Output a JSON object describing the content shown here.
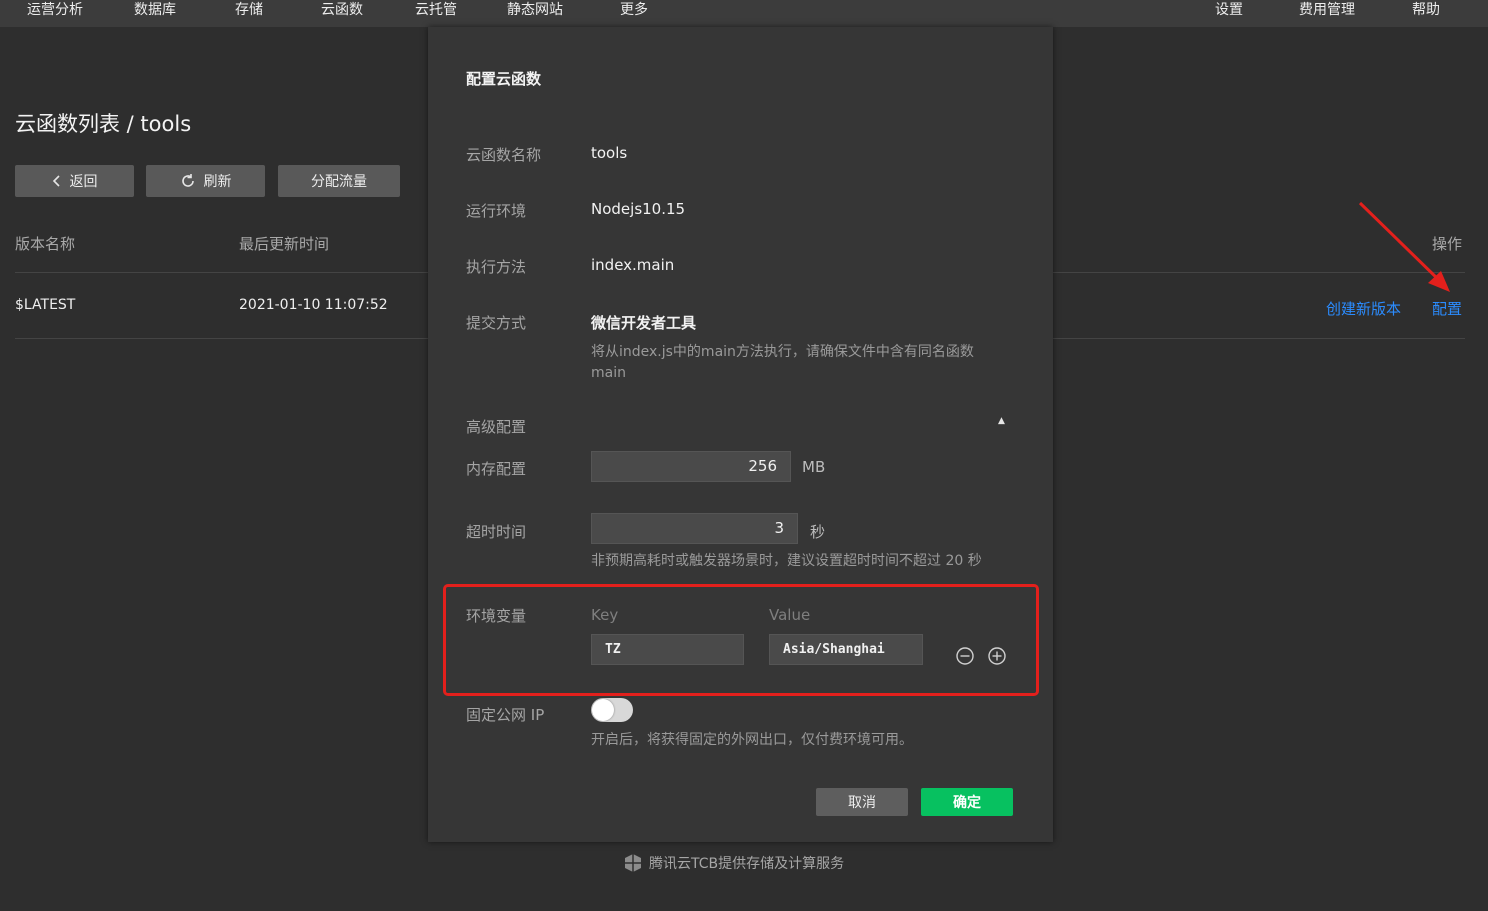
{
  "nav": {
    "left": [
      "运营分析",
      "数据库",
      "存储",
      "云函数",
      "云托管",
      "静态网站",
      "更多"
    ],
    "right": [
      "设置",
      "费用管理",
      "帮助"
    ]
  },
  "page": {
    "title": "云函数列表 / tools",
    "buttons": {
      "back": "返回",
      "refresh": "刷新",
      "traffic": "分配流量"
    },
    "table": {
      "headers": {
        "version": "版本名称",
        "updated": "最后更新时间",
        "actions": "操作"
      },
      "row": {
        "version": "$LATEST",
        "updated": "2021-01-10 11:07:52"
      },
      "actions": {
        "create_version": "创建新版本",
        "config": "配置"
      }
    }
  },
  "dialog": {
    "title": "配置云函数",
    "name_label": "云函数名称",
    "name_value": "tools",
    "runtime_label": "运行环境",
    "runtime_value": "Nodejs10.15",
    "handler_label": "执行方法",
    "handler_value": "index.main",
    "submit_label": "提交方式",
    "submit_value": "微信开发者工具",
    "submit_hint": "将从index.js中的main方法执行，请确保文件中含有同名函数main",
    "advanced_label": "高级配置",
    "advanced_toggle": "▲",
    "memory_label": "内存配置",
    "memory_value": "256",
    "memory_unit": "MB",
    "timeout_label": "超时时间",
    "timeout_value": "3",
    "timeout_unit": "秒",
    "timeout_hint": "非预期高耗时或触发器场景时，建议设置超时时间不超过 20 秒",
    "env_label": "环境变量",
    "env_key_header": "Key",
    "env_value_header": "Value",
    "env_key": "TZ",
    "env_value": "Asia/Shanghai",
    "fixed_ip_label": "固定公网 IP",
    "fixed_ip_enabled": false,
    "fixed_ip_hint": "开启后，将获得固定的外网出口，仅付费环境可用。",
    "cancel": "取消",
    "confirm": "确定"
  },
  "footer": {
    "text": "腾讯云TCB提供存储及计算服务"
  },
  "colors": {
    "link": "#2b8cff",
    "confirm": "#07c160",
    "highlight": "#e3201c"
  }
}
